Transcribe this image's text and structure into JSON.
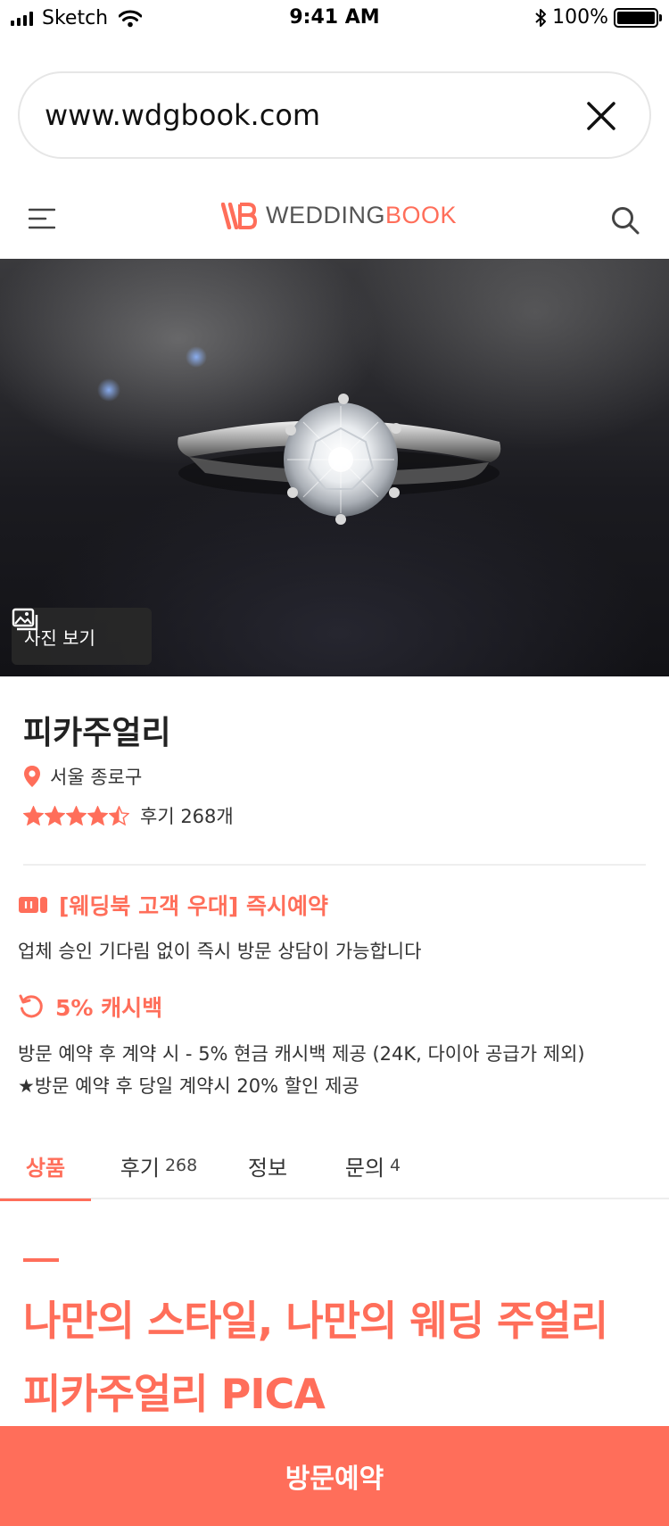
{
  "status_bar": {
    "carrier": "Sketch",
    "time": "9:41 AM",
    "battery": "100%",
    "icons": [
      "signal-icon",
      "wifi-icon",
      "bluetooth-icon",
      "battery-icon"
    ]
  },
  "browser": {
    "url": "www.wdgbook.com",
    "close_icon": "close-icon"
  },
  "header": {
    "logo_left": "WEDDING",
    "logo_right": "BOOK",
    "menu_icon": "menu-icon",
    "search_icon": "search-icon"
  },
  "hero": {
    "photo_button": "사진 보기",
    "photo_icon": "gallery-icon"
  },
  "vendor": {
    "name": "피카주얼리",
    "location": "서울 종로구",
    "rating": 4.5,
    "reviews_label": "후기 268개"
  },
  "benefits": [
    {
      "icon": "ticket-icon",
      "title": "[웨딩북 고객 우대] 즉시예약",
      "desc": [
        "업체 승인 기다림 없이 즉시 방문 상담이 가능합니다"
      ]
    },
    {
      "icon": "cashback-icon",
      "title": "5% 캐시백",
      "desc": [
        "방문 예약 후 계약 시 - 5% 현금 캐시백 제공 (24K, 다이아 공급가 제외)",
        "★방문 예약 후 당일 계약시 20% 할인 제공"
      ]
    }
  ],
  "tabs": [
    {
      "label": "상품",
      "count": "",
      "active": true
    },
    {
      "label": "후기",
      "count": "268",
      "active": false
    },
    {
      "label": "정보",
      "count": "",
      "active": false
    },
    {
      "label": "문의",
      "count": "4",
      "active": false
    }
  ],
  "headline": {
    "line1": "나만의 스타일, 나만의 웨딩 주얼리",
    "line2": "피카주얼리 PICA"
  },
  "cta": {
    "label": "방문예약"
  },
  "colors": {
    "accent": "#ff6e5a",
    "text": "#222222",
    "divider": "#eeeeee"
  }
}
